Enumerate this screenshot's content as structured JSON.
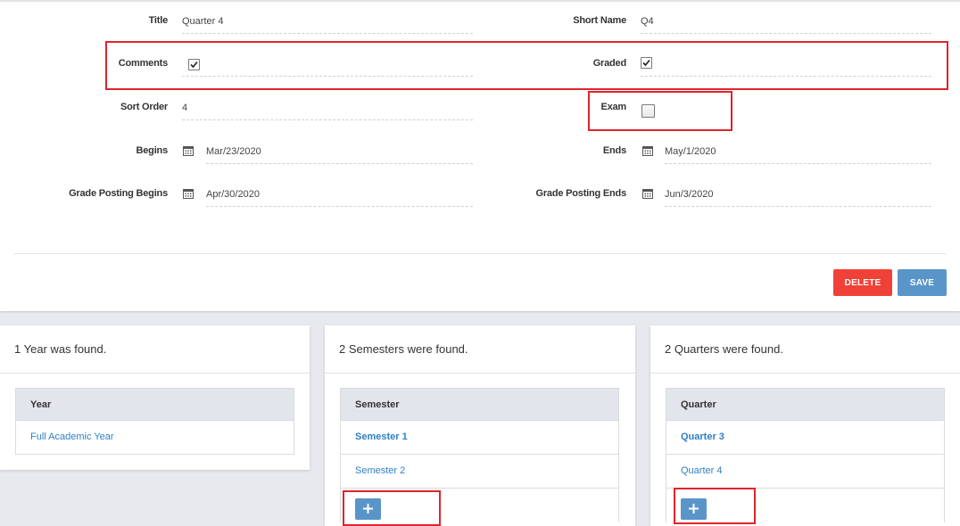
{
  "form": {
    "title": {
      "label": "Title",
      "value": "Quarter 4"
    },
    "short_name": {
      "label": "Short Name",
      "value": "Q4"
    },
    "comments": {
      "label": "Comments",
      "checked": true
    },
    "graded": {
      "label": "Graded",
      "checked": true
    },
    "sort_order": {
      "label": "Sort Order",
      "value": "4"
    },
    "exam": {
      "label": "Exam",
      "checked": false
    },
    "begins": {
      "label": "Begins",
      "value": "Mar/23/2020"
    },
    "ends": {
      "label": "Ends",
      "value": "May/1/2020"
    },
    "grade_posting_begins": {
      "label": "Grade Posting Begins",
      "value": "Apr/30/2020"
    },
    "grade_posting_ends": {
      "label": "Grade Posting Ends",
      "value": "Jun/3/2020"
    },
    "delete_label": "DELETE",
    "save_label": "SAVE"
  },
  "panels": {
    "years": {
      "summary": "1 Year was found.",
      "header": "Year",
      "rows": [
        {
          "label": "Full Academic Year",
          "active": false
        }
      ]
    },
    "semesters": {
      "summary": "2 Semesters were found.",
      "header": "Semester",
      "rows": [
        {
          "label": "Semester 1",
          "active": true
        },
        {
          "label": "Semester 2",
          "active": false
        }
      ]
    },
    "quarters": {
      "summary": "2 Quarters were found.",
      "header": "Quarter",
      "rows": [
        {
          "label": "Quarter 3",
          "active": true
        },
        {
          "label": "Quarter 4",
          "active": false
        }
      ]
    }
  },
  "icons": {
    "calendar": "calendar-icon",
    "check": "check-icon",
    "add": "plus-icon"
  },
  "colors": {
    "accent": "#5a95c9",
    "danger": "#f04138",
    "link": "#2f7fc7",
    "highlight": "#e0242b"
  }
}
